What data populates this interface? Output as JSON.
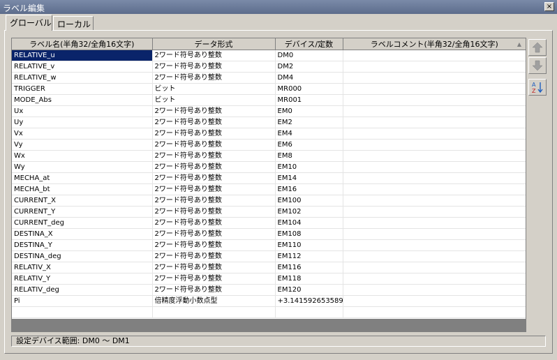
{
  "window": {
    "title": "ラベル編集",
    "close_glyph": "×"
  },
  "tabs": [
    {
      "label": "グローバル",
      "active": true
    },
    {
      "label": "ローカル",
      "active": false
    }
  ],
  "table": {
    "columns": [
      "ラベル名(半角32/全角16文字)",
      "データ形式",
      "デバイス/定数",
      "ラベルコメント(半角32/全角16文字)"
    ],
    "rows": [
      {
        "name": "RELATIVE_u",
        "type": "2ワード符号あり整数",
        "device": "DM0",
        "comment": "",
        "selected": true
      },
      {
        "name": "RELATIVE_v",
        "type": "2ワード符号あり整数",
        "device": "DM2",
        "comment": ""
      },
      {
        "name": "RELATIVE_w",
        "type": "2ワード符号あり整数",
        "device": "DM4",
        "comment": ""
      },
      {
        "name": "TRIGGER",
        "type": "ビット",
        "device": "MR000",
        "comment": ""
      },
      {
        "name": "MODE_Abs",
        "type": "ビット",
        "device": "MR001",
        "comment": ""
      },
      {
        "name": "Ux",
        "type": "2ワード符号あり整数",
        "device": "EM0",
        "comment": ""
      },
      {
        "name": "Uy",
        "type": "2ワード符号あり整数",
        "device": "EM2",
        "comment": ""
      },
      {
        "name": "Vx",
        "type": "2ワード符号あり整数",
        "device": "EM4",
        "comment": ""
      },
      {
        "name": "Vy",
        "type": "2ワード符号あり整数",
        "device": "EM6",
        "comment": ""
      },
      {
        "name": "Wx",
        "type": "2ワード符号あり整数",
        "device": "EM8",
        "comment": ""
      },
      {
        "name": "Wy",
        "type": "2ワード符号あり整数",
        "device": "EM10",
        "comment": ""
      },
      {
        "name": "MECHA_at",
        "type": "2ワード符号あり整数",
        "device": "EM14",
        "comment": ""
      },
      {
        "name": "MECHA_bt",
        "type": "2ワード符号あり整数",
        "device": "EM16",
        "comment": ""
      },
      {
        "name": "CURRENT_X",
        "type": "2ワード符号あり整数",
        "device": "EM100",
        "comment": ""
      },
      {
        "name": "CURRENT_Y",
        "type": "2ワード符号あり整数",
        "device": "EM102",
        "comment": ""
      },
      {
        "name": "CURRENT_deg",
        "type": "2ワード符号あり整数",
        "device": "EM104",
        "comment": ""
      },
      {
        "name": "DESTINA_X",
        "type": "2ワード符号あり整数",
        "device": "EM108",
        "comment": ""
      },
      {
        "name": "DESTINA_Y",
        "type": "2ワード符号あり整数",
        "device": "EM110",
        "comment": ""
      },
      {
        "name": "DESTINA_deg",
        "type": "2ワード符号あり整数",
        "device": "EM112",
        "comment": ""
      },
      {
        "name": "RELATIV_X",
        "type": "2ワード符号あり整数",
        "device": "EM116",
        "comment": ""
      },
      {
        "name": "RELATIV_Y",
        "type": "2ワード符号あり整数",
        "device": "EM118",
        "comment": ""
      },
      {
        "name": "RELATIV_deg",
        "type": "2ワード符号あり整数",
        "device": "EM120",
        "comment": ""
      },
      {
        "name": "Pi",
        "type": "倍精度浮動小数点型",
        "device": "+3.141592653589",
        "comment": ""
      },
      {
        "name": "",
        "type": "",
        "device": "",
        "comment": ""
      }
    ]
  },
  "side_buttons": [
    {
      "icon": "arrow-up-icon",
      "enabled": false
    },
    {
      "icon": "arrow-down-icon",
      "enabled": false
    },
    {
      "icon": "sort-az-icon",
      "enabled": true
    }
  ],
  "status": {
    "text": "設定デバイス範囲: DM0 〜 DM1"
  },
  "colors": {
    "selection": "#0a246a",
    "face": "#d4d0c8",
    "grid_empty": "#808080"
  }
}
